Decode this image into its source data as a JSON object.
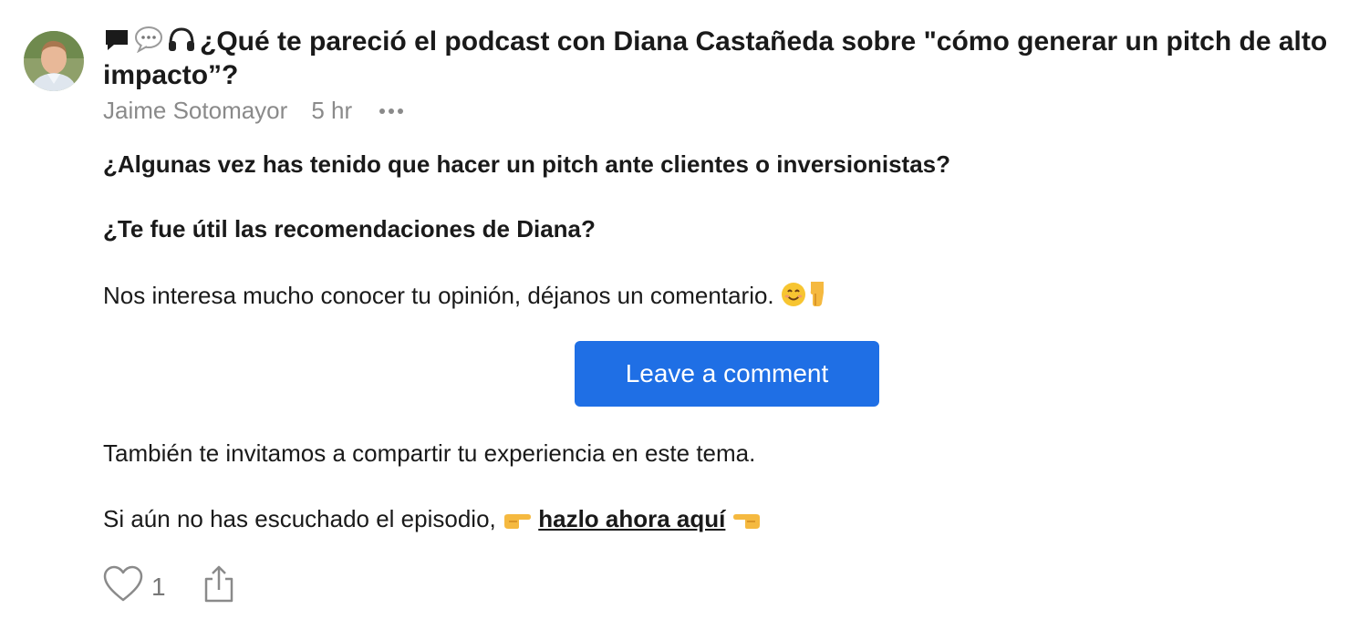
{
  "post": {
    "title": "¿Qué te pareció el podcast con Diana Castañeda sobre \"cómo generar un pitch de alto impacto”?",
    "title_icons": [
      "speech-bubble-black-icon",
      "speech-bubble-white-icon",
      "headphones-icon"
    ],
    "author": "Jaime Sotomayor",
    "time_ago": "5 hr"
  },
  "content": {
    "question1": "¿Algunas vez has tenido que hacer un pitch ante clientes o inversionistas?",
    "question2": "¿Te fue útil las recomendaciones de Diana?",
    "invite_comment": "Nos interesa mucho conocer tu opinión, déjanos un comentario.",
    "invite_comment_emojis": [
      "smiling-face-icon",
      "pointing-down-icon"
    ],
    "cta_label": "Leave a comment",
    "share_experience": "También te invitamos a compartir tu experiencia en este tema.",
    "listen_prefix": "Si aún no has escuchado el episodio,",
    "listen_link": "hazlo ahora aquí",
    "listen_emojis": [
      "pointing-right-icon",
      "pointing-left-icon"
    ]
  },
  "actions": {
    "like_count": "1"
  },
  "colors": {
    "accent": "#1f6fe5",
    "text": "#1a1a1a",
    "muted": "#8a8a8a"
  }
}
